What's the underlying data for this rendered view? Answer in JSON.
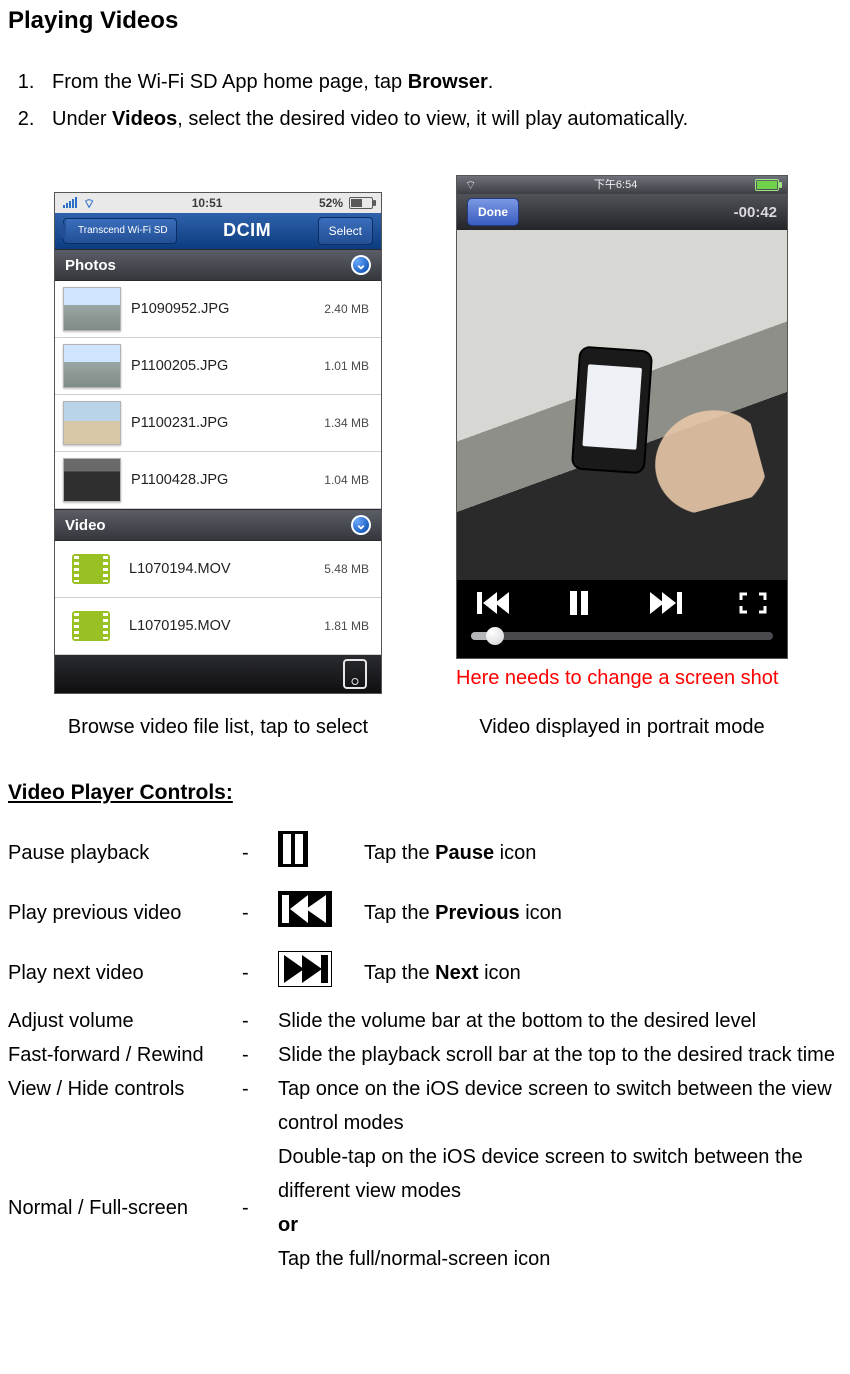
{
  "title": "Playing Videos",
  "steps": {
    "s1_a": "From the Wi-Fi SD App home page, tap ",
    "s1_b": "Browser",
    "s1_c": ".",
    "s2_a": "Under ",
    "s2_b": "Videos",
    "s2_c": ", select the desired video to view, it will play automatically."
  },
  "phone1": {
    "status": {
      "time": "10:51",
      "battery": "52%"
    },
    "back": "Transcend Wi-Fi SD",
    "title": "DCIM",
    "select": "Select",
    "sections": {
      "photos": "Photos",
      "video": "Video"
    },
    "photos": [
      {
        "name": "P1090952.JPG",
        "size": "2.40 MB"
      },
      {
        "name": "P1100205.JPG",
        "size": "1.01 MB"
      },
      {
        "name": "P1100231.JPG",
        "size": "1.34 MB"
      },
      {
        "name": "P1100428.JPG",
        "size": "1.04 MB"
      }
    ],
    "videos": [
      {
        "name": "L1070194.MOV",
        "size": "5.48 MB"
      },
      {
        "name": "L1070195.MOV",
        "size": "1.81 MB"
      }
    ],
    "caption": "Browse video file list, tap to select"
  },
  "phone2": {
    "status_time": "下午6:54",
    "done": "Done",
    "time_remaining": "-00:42",
    "note": "Here needs to change a screen shot",
    "caption": "Video displayed in portrait mode"
  },
  "controls_heading": "Video Player Controls:",
  "controls": {
    "dash": "-",
    "pause_label": "Pause playback",
    "pause_desc_a": "Tap the ",
    "pause_desc_b": "Pause",
    "pause_desc_c": " icon",
    "prev_label": "Play previous video",
    "prev_desc_a": "Tap the ",
    "prev_desc_b": "Previous",
    "prev_desc_c": " icon",
    "next_label": "Play next video",
    "next_desc_a": "Tap the ",
    "next_desc_b": "Next",
    "next_desc_c": " icon",
    "volume_label": "Adjust volume",
    "volume_desc": "Slide the volume bar at the bottom to the desired level",
    "ff_label": "Fast-forward / Rewind",
    "ff_desc": "Slide the playback scroll bar at the top to the desired track time",
    "view_label": "View / Hide controls",
    "view_desc": "Tap once on the iOS device screen to switch between the view control modes",
    "full_label": "Normal / Full-screen",
    "full_desc_1": "Double-tap on the iOS device screen to switch between the different view modes",
    "full_desc_or": "or",
    "full_desc_2": "Tap the full/normal-screen icon"
  }
}
